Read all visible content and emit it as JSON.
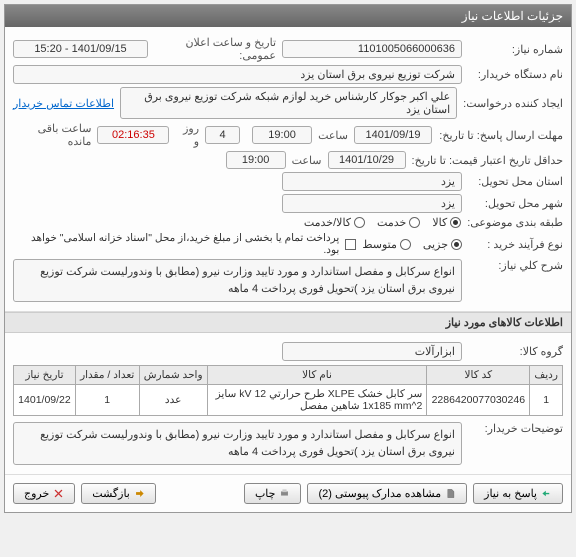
{
  "panel": {
    "title": "جزئیات اطلاعات نیاز"
  },
  "info": {
    "need_no_label": "شماره نیاز:",
    "need_no": "1101005066000636",
    "pub_label": "تاریخ و ساعت اعلان عمومی:",
    "pub_value": "1401/09/15 - 15:20",
    "org_label": "نام دستگاه خریدار:",
    "org_value": "شرکت توزیع نیروی برق استان یزد",
    "creator_label": "ایجاد کننده درخواست:",
    "creator_value": "علي اکبر  جوکار   کارشناس خرید لوازم شبکه   شرکت توزیع نیروی برق استان یزد",
    "contact_link": "اطلاعات تماس خریدار",
    "reply_label": "مهلت ارسال پاسخ: تا تاریخ:",
    "reply_date": "1401/09/19",
    "time_label": "ساعت",
    "reply_time": "19:00",
    "days_value": "4",
    "days_label": "روز و",
    "countdown": "02:16:35",
    "remaining": "ساعت باقی مانده",
    "valid_label": "حداقل تاریخ اعتبار قیمت: تا تاریخ:",
    "valid_date": "1401/10/29",
    "valid_time": "19:00",
    "loc_label": "استان محل تحویل:",
    "loc_value": "یزد",
    "city_label": "شهر محل تحویل:",
    "city_value": "یزد",
    "pack_label": "طبقه بندی موضوعی:",
    "pack_opts": [
      "کالا",
      "خدمت",
      "کالا/خدمت"
    ],
    "pack_sel": 0,
    "proc_label": "نوع فرآیند خرید :",
    "proc_opts": [
      "جزیی",
      "متوسط"
    ],
    "proc_sel": 0,
    "chk_label": "پرداخت تمام یا بخشی از مبلغ خرید،از محل \"اسناد خزانه اسلامی\" خواهد بود.",
    "desc_label": "شرح کلي نیاز:",
    "desc_value": "انواع سرکابل و مفصل استاندارد و مورد تایید وزارت نیرو (مطابق با وندورلیست شرکت توزیع نیروی برق استان یزد )تحویل فوری پرداخت 4 ماهه"
  },
  "items_section": {
    "title": "اطلاعات کالاهای مورد نیاز",
    "group_label": "گروه کالا:",
    "group_value": "ابزارآلات",
    "headers": [
      "ردیف",
      "کد کالا",
      "نام کالا",
      "واحد شمارش",
      "تعداد / مقدار",
      "تاریخ نیاز"
    ],
    "rows": [
      {
        "idx": "1",
        "code": "2286420077030246",
        "name": "سر کابل خشک XLPE طرح حرارتي 12 kV سایز 1x185 mm^2 شاهین مفصل",
        "unit": "عدد",
        "qty": "1",
        "date": "1401/09/22"
      }
    ],
    "buyer_note_label": "توضیحات خریدار:",
    "buyer_note": "انواع سرکابل و مفصل استاندارد و مورد تایید وزارت نیرو (مطابق با وندورلیست شرکت توزیع نیروی برق استان یزد )تحویل فوری پرداخت 4 ماهه"
  },
  "buttons": {
    "answer": "پاسخ به نیاز",
    "attachments": "مشاهده مدارک پیوستی (2)",
    "print": "چاپ",
    "back": "بازگشت",
    "exit": "خروج"
  }
}
